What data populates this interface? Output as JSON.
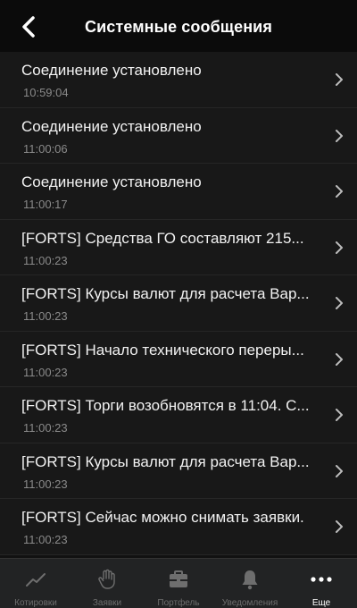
{
  "header": {
    "title": "Системные сообщения",
    "back_icon": "chevron-left-icon"
  },
  "messages": [
    {
      "title": "Соединение установлено",
      "time": "10:59:04"
    },
    {
      "title": "Соединение установлено",
      "time": "11:00:06"
    },
    {
      "title": "Соединение установлено",
      "time": "11:00:17"
    },
    {
      "title": "[FORTS] Средства ГО составляют 215...",
      "time": "11:00:23"
    },
    {
      "title": "[FORTS] Курсы валют для расчета Вар...",
      "time": "11:00:23"
    },
    {
      "title": "[FORTS] Начало технического переры...",
      "time": "11:00:23"
    },
    {
      "title": "[FORTS] Торги возобновятся в 11:04. С...",
      "time": "11:00:23"
    },
    {
      "title": "[FORTS] Курсы валют для расчета Вар...",
      "time": "11:00:23"
    },
    {
      "title": "[FORTS] Сейчас можно снимать заявки.",
      "time": "11:00:23"
    }
  ],
  "tabbar": {
    "tabs": [
      {
        "label": "Котировки",
        "icon": "chart-line-icon",
        "active": false
      },
      {
        "label": "Заявки",
        "icon": "hand-icon",
        "active": false
      },
      {
        "label": "Портфель",
        "icon": "briefcase-icon",
        "active": false
      },
      {
        "label": "Уведомления",
        "icon": "bell-icon",
        "active": false
      },
      {
        "label": "Еще",
        "icon": "more-dots-icon",
        "active": true
      }
    ]
  },
  "colors": {
    "background": "#111111",
    "row": "#181818",
    "divider": "#262626",
    "tabbar": "#222324",
    "inactive_tab": "#6e6e6e",
    "active_tab": "#ffffff",
    "time_text": "#8a8a8a"
  }
}
